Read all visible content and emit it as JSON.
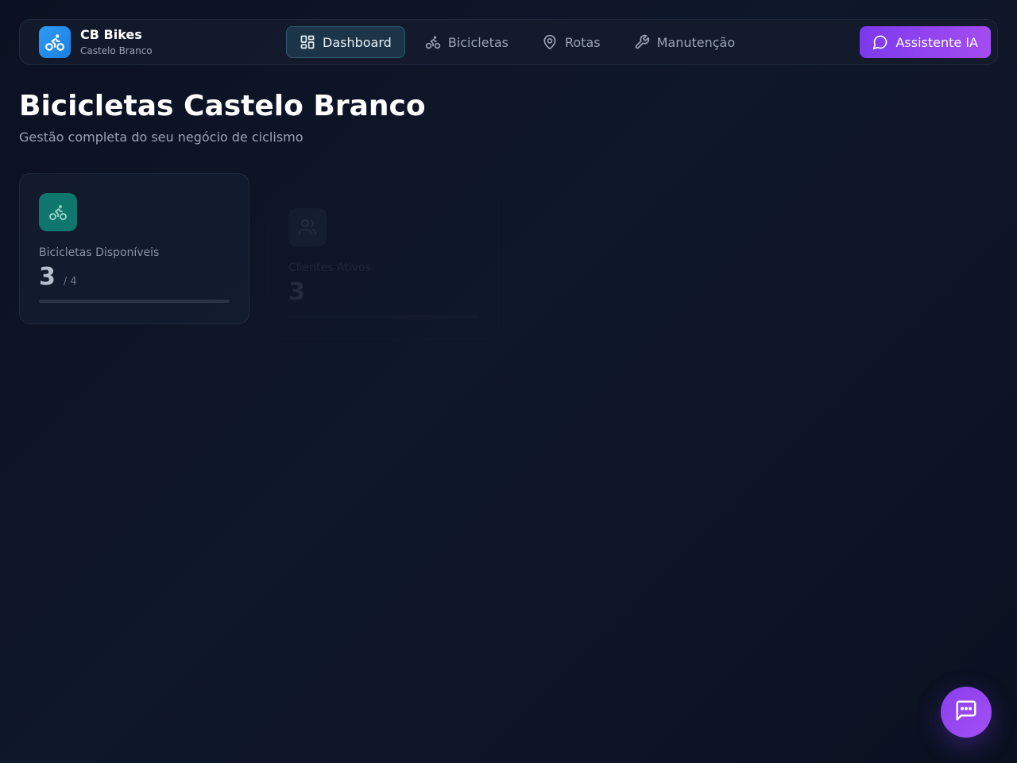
{
  "brand": {
    "name": "CB Bikes",
    "subtitle": "Castelo Branco"
  },
  "nav": {
    "items": [
      {
        "label": "Dashboard",
        "icon": "grid-icon",
        "active": true
      },
      {
        "label": "Bicicletas",
        "icon": "bike-icon",
        "active": false
      },
      {
        "label": "Rotas",
        "icon": "map-pin-icon",
        "active": false
      },
      {
        "label": "Manutenção",
        "icon": "wrench-icon",
        "active": false
      }
    ],
    "ai_button": "Assistente IA"
  },
  "header": {
    "title": "Bicicletas Castelo Branco",
    "subtitle": "Gestão completa do seu negócio de ciclismo"
  },
  "stats": [
    {
      "label": "Bicicletas Disponíveis",
      "value": "3",
      "total": "/ 4",
      "icon": "bike-icon",
      "icon_color": "#0f766e"
    },
    {
      "label": "Clientes Ativos",
      "value": "3",
      "icon": "users-icon",
      "icon_color": "#475569"
    }
  ],
  "colors": {
    "accent": "#7c3aed",
    "brand": "#2f9bf3",
    "active_nav": "#2e5b70"
  }
}
